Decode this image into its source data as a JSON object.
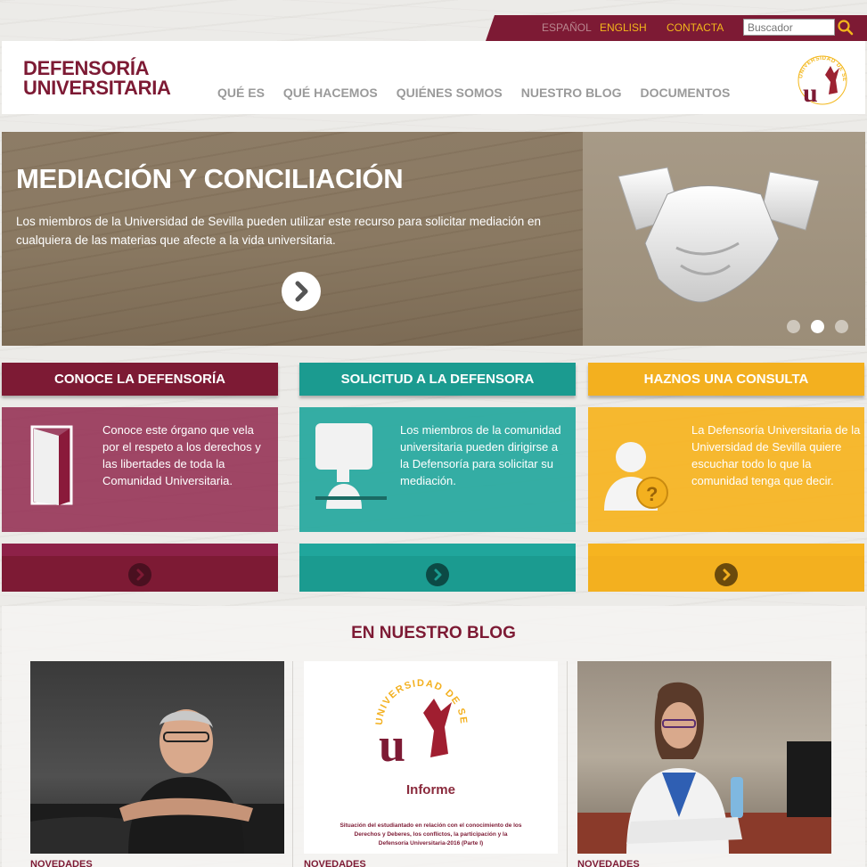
{
  "topbar": {
    "lang_es": "ESPAÑOL",
    "lang_en": "ENGLISH",
    "contact": "CONTACTA",
    "search_placeholder": "Buscador"
  },
  "header": {
    "brand_line1": "DEFENSORÍA",
    "brand_line2": "UNIVERSITARIA",
    "nav": [
      "QUÉ ES",
      "QUÉ HACEMOS",
      "QUIÉNES SOMOS",
      "NUESTRO BLOG",
      "DOCUMENTOS"
    ],
    "logo_text": "UNIVERSIDAD DE SEVILLA"
  },
  "hero": {
    "title": "MEDIACIÓN Y CONCILIACIÓN",
    "text": "Los miembros de la Universidad de Sevilla pueden utilizar este recurso para solicitar mediación en cualquiera de las materias que afecte a la vida universitaria.",
    "slides": 3,
    "active_slide": 2
  },
  "cards": [
    {
      "title": "CONOCE LA DEFENSORÍA",
      "text": "Conoce este órgano que vela por el respeto a los derechos y las libertades de toda la Comunidad Universitaria.",
      "icon": "door-icon",
      "color": "#7d1a34"
    },
    {
      "title": "SOLICITUD A LA DEFENSORA",
      "text": "Los miembros de la comunidad universitaria pueden dirigirse a la Defensoría para solicitar su mediación.",
      "icon": "speaker-icon",
      "color": "#1b9b90"
    },
    {
      "title": "HAZNOS UNA CONSULTA",
      "text": "La Defensoría Universitaria de la Universidad de Sevilla quiere escuchar todo lo que la comunidad tenga que decir.",
      "icon": "user-question-icon",
      "color": "#f3b01f"
    }
  ],
  "blog": {
    "title": "EN NUESTRO BLOG",
    "posts": [
      {
        "category": "NOVEDADES"
      },
      {
        "category": "NOVEDADES",
        "image_logo_text": "UNIVERSIDAD DE SEVILLA",
        "image_title": "Informe",
        "image_caption": "Situación del estudiantado en relación con el conocimiento de los Derechos y Deberes, los conflictos, la participación y la Defensoría Universitaria-2016 (Parte I)"
      },
      {
        "category": "NOVEDADES"
      }
    ]
  }
}
